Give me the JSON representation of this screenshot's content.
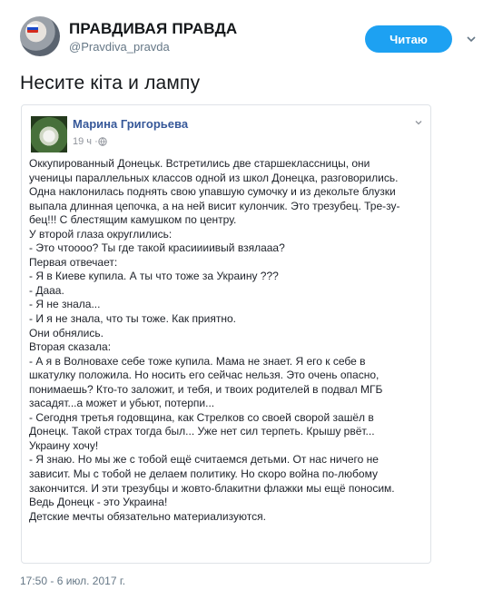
{
  "tweet": {
    "author_name": "ПРАВДИВАЯ ПРАВДА",
    "author_handle": "@Pravdiva_pravda",
    "follow_label": "Читаю",
    "text": "Несите кіта и лампу",
    "timestamp": "17:50 - 6 июл. 2017 г."
  },
  "embedded_post": {
    "author": "Марина Григорьева",
    "time": "19 ч ·",
    "lines": [
      "Оккупированный Донецьк. Встретились две старшеклассницы, они",
      "ученицы параллельных классов одной из школ Донецка, разговорились.",
      "Одна наклонилась поднять свою упавшую сумочку и из декольте блузки",
      "выпала длинная цепочка, а на ней висит кулончик. Это трезубец. Тре-зу-",
      "бец!!! С блестящим камушком по центру.",
      "У второй глаза округлились:",
      "- Это чтоооо? Ты где такой красиииивый взялааа?",
      "Первая отвечает:",
      "- Я в Киеве купила. А ты что тоже за Украину ???",
      "- Дааа.",
      "- Я не знала...",
      "- И я не знала, что ты тоже. Как приятно.",
      "Они обнялись.",
      "Вторая сказала:",
      "- А я в Волновахе себе тоже купила. Мама не знает. Я его к себе в",
      "шкатулку положила. Но носить его сейчас нельзя. Это очень опасно,",
      "понимаешь? Кто-то заложит, и тебя, и твоих родителей в подвал МГБ",
      "засадят...а может и убьют, потерпи...",
      "- Сегодня третья годовщина, как Стрелков со своей сворой зашёл в",
      "Донецк. Такой страх тогда был... Уже нет сил терпеть. Крышу рвёт...",
      "Украину хочу!",
      "- Я знаю. Но мы же с тобой ещё считаемся детьми. От нас ничего не",
      "зависит. Мы с тобой не делаем политику. Но скоро война по-любому",
      "закончится. И эти трезубцы и жовто-блакитни флажки мы ещё поносим.",
      "Ведь Донецк - это Украина!",
      "Детские мечты обязательно материализуются."
    ]
  },
  "icons": {
    "chevron": "chevron-down-icon",
    "globe": "globe-icon"
  },
  "colors": {
    "accent": "#1da1f2",
    "facebook_name": "#365899"
  }
}
